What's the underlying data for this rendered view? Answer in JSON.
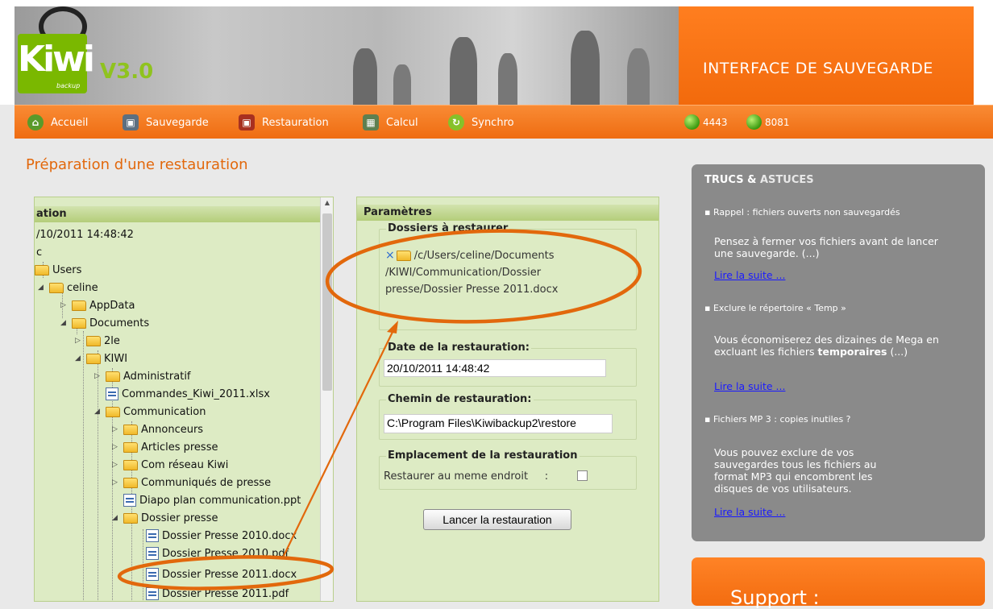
{
  "header": {
    "logo_text": "Kiwi",
    "logo_sub": "backup",
    "version": "V3.0",
    "title": "INTERFACE DE SAUVEGARDE"
  },
  "nav": {
    "items": [
      {
        "label": "Accueil",
        "icon": "home-icon",
        "color": "#4a8a1a"
      },
      {
        "label": "Sauvegarde",
        "icon": "backup-icon",
        "color": "#6a7a8a"
      },
      {
        "label": "Restauration",
        "icon": "restore-icon",
        "color": "#b03020"
      },
      {
        "label": "Calcul",
        "icon": "calculator-icon",
        "color": "#6a8a5a"
      },
      {
        "label": "Synchro",
        "icon": "sync-icon",
        "color": "#7ab800"
      }
    ],
    "ports": [
      "4443",
      "8081"
    ]
  },
  "page_title": "Préparation d'une restauration",
  "tree": {
    "header": "ation",
    "date": "/10/2011 14:48:42",
    "nodes": [
      {
        "label": "c",
        "type": "text"
      },
      {
        "label": "Users",
        "type": "folder"
      },
      {
        "label": "celine",
        "type": "folder"
      },
      {
        "label": "AppData",
        "type": "folder"
      },
      {
        "label": "Documents",
        "type": "folder"
      },
      {
        "label": "2le",
        "type": "folder"
      },
      {
        "label": "KIWI",
        "type": "folder"
      },
      {
        "label": "Administratif",
        "type": "folder"
      },
      {
        "label": "Commandes_Kiwi_2011.xlsx",
        "type": "file"
      },
      {
        "label": "Communication",
        "type": "folder"
      },
      {
        "label": "Annonceurs",
        "type": "folder"
      },
      {
        "label": "Articles presse",
        "type": "folder"
      },
      {
        "label": "Com réseau Kiwi",
        "type": "folder"
      },
      {
        "label": "Communiqués de presse",
        "type": "folder"
      },
      {
        "label": "Diapo plan communication.ppt",
        "type": "file"
      },
      {
        "label": "Dossier presse",
        "type": "folder"
      },
      {
        "label": "Dossier Presse 2010.docx",
        "type": "file"
      },
      {
        "label": "Dossier Presse 2010.pdf",
        "type": "file"
      },
      {
        "label": "Dossier Presse 2011.docx",
        "type": "file"
      },
      {
        "label": "Dossier Presse 2011.pdf",
        "type": "file"
      }
    ]
  },
  "params": {
    "header": "Paramètres",
    "folders_legend": "Dossiers à restaurer",
    "folder_path_lines": [
      "/c/Users/celine/Documents",
      "/KIWI/Communication/Dossier",
      "presse/Dossier Presse 2011.docx"
    ],
    "remove_glyph": "×",
    "date_legend": "Date de la restauration:",
    "date_value": "20/10/2011 14:48:42",
    "path_legend": "Chemin de restauration:",
    "path_value": "C:\\Program Files\\Kiwibackup2\\restore",
    "location_legend": "Emplacement de la restauration",
    "same_place_label": "Restaurer au meme endroit     :",
    "same_place_checked": false,
    "launch_button": "Lancer la restauration"
  },
  "tips": {
    "title_a": "TRUCS &",
    "title_b": "ASTUCES",
    "items": [
      {
        "head": "Rappel : fichiers ouverts non sauvegardés",
        "body": "Pensez à fermer vos fichiers avant de lancer une sauvegarde. (...)",
        "link": "Lire la suite ..."
      },
      {
        "head": "Exclure le répertoire « Temp »",
        "body_a": "Vous économiserez des dizaines de Mega en excluant les fichiers",
        "body_b": "temporaires",
        "body_c": " (...)",
        "link": "Lire la suite ..."
      },
      {
        "head": "Fichiers MP 3 : copies inutiles ?",
        "body": "Vous pouvez exclure de vos sauvegardes tous les fichiers au format MP3 qui encombrent les disques de vos utilisateurs.",
        "link": "Lire la suite ..."
      }
    ]
  },
  "support": {
    "title": "Support :"
  },
  "colors": {
    "accent": "#ef6c12",
    "panel": "#ddebc4",
    "annotation": "#e2680c"
  }
}
